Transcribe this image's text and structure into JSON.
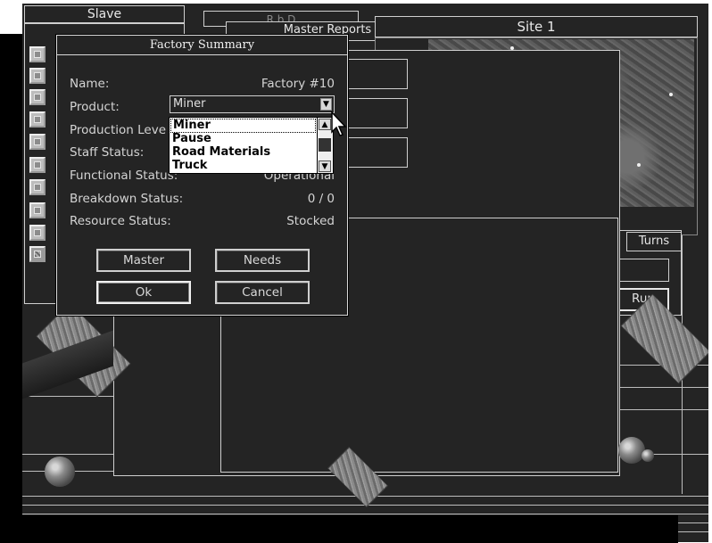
{
  "panels": {
    "slave_title": "Slave",
    "master_reports_title": "Master Reports",
    "site_title": "Site 1",
    "hidden_title_fragment": "R  b  D",
    "turns_label": "Turns",
    "run_label": "Run"
  },
  "dialog": {
    "title": "Factory Summary",
    "rows": [
      {
        "label": "Name:",
        "value": "Factory #10"
      },
      {
        "label": "Product:",
        "value": ""
      },
      {
        "label": "Production Leve",
        "value": ""
      },
      {
        "label": "Staff Status:",
        "value": ""
      },
      {
        "label": "Functional Status:",
        "value": "Operational"
      },
      {
        "label": "Breakdown Status:",
        "value": "0 / 0"
      },
      {
        "label": "Resource Status:",
        "value": "Stocked"
      }
    ],
    "product_select": {
      "selected": "Miner",
      "options": [
        "Miner",
        "Pause",
        "Road Materials",
        "Truck"
      ]
    },
    "buttons": {
      "master": "Master",
      "needs": "Needs",
      "ok": "Ok",
      "cancel": "Cancel"
    }
  },
  "icons": {
    "scroll_up": "▲",
    "scroll_down": "▼",
    "combo_arrow": "▼"
  }
}
